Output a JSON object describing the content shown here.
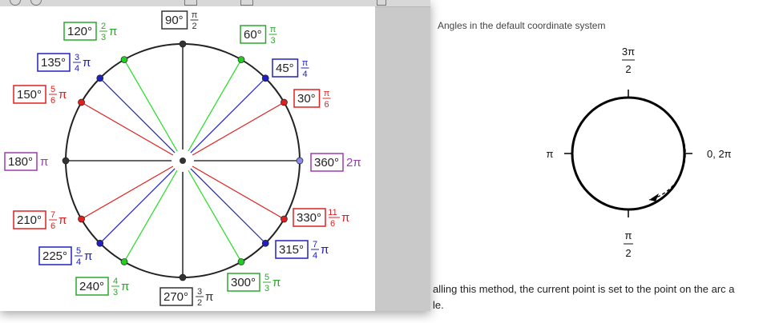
{
  "doc": {
    "caption": "Angles in the default coordinate system",
    "body_line_1": "alling this method, the current point is set to the point on the arc a",
    "body_line_2": "le.",
    "diagram": {
      "top_label_num": "3π",
      "top_label_den": "2",
      "left_label": "π",
      "right_label": "0, 2π",
      "bottom_label_num": "π",
      "bottom_label_den": "2"
    }
  },
  "unit_circle": {
    "angles": [
      {
        "id": "deg-0",
        "deg": 0,
        "label": "360°",
        "rad_num": "",
        "rad_den": "",
        "rad_tail": "2π",
        "color": "#9a3fb0",
        "dot": "#8a8ae8"
      },
      {
        "id": "deg-30",
        "deg": 30,
        "label": "30°",
        "rad_num": "π",
        "rad_den": "6",
        "rad_tail": "",
        "color": "#e02020",
        "dot": "#e02020"
      },
      {
        "id": "deg-45",
        "deg": 45,
        "label": "45°",
        "rad_num": "π",
        "rad_den": "4",
        "rad_tail": "",
        "color": "#2020c0",
        "dot": "#2020c0"
      },
      {
        "id": "deg-60",
        "deg": 60,
        "label": "60°",
        "rad_num": "π",
        "rad_den": "3",
        "rad_tail": "",
        "color": "#2aa82a",
        "dot": "#22cc22"
      },
      {
        "id": "deg-90",
        "deg": 90,
        "label": "90°",
        "rad_num": "π",
        "rad_den": "2",
        "rad_tail": "",
        "color": "#333333",
        "dot": "#333333"
      },
      {
        "id": "deg-120",
        "deg": 120,
        "label": "120°",
        "rad_num": "2",
        "rad_den": "3",
        "rad_tail": "π",
        "color": "#2aa82a",
        "dot": "#22cc22"
      },
      {
        "id": "deg-135",
        "deg": 135,
        "label": "135°",
        "rad_num": "3",
        "rad_den": "4",
        "rad_tail": "π",
        "color": "#2020c0",
        "dot": "#2020c0"
      },
      {
        "id": "deg-150",
        "deg": 150,
        "label": "150°",
        "rad_num": "5",
        "rad_den": "6",
        "rad_tail": "π",
        "color": "#e02020",
        "dot": "#e02020"
      },
      {
        "id": "deg-180",
        "deg": 180,
        "label": "180°",
        "rad_num": "",
        "rad_den": "",
        "rad_tail": "π",
        "color": "#9a3fb0",
        "dot": "#333333"
      },
      {
        "id": "deg-210",
        "deg": 210,
        "label": "210°",
        "rad_num": "7",
        "rad_den": "6",
        "rad_tail": "π",
        "color": "#e02020",
        "dot": "#e02020"
      },
      {
        "id": "deg-225",
        "deg": 225,
        "label": "225°",
        "rad_num": "5",
        "rad_den": "4",
        "rad_tail": "π",
        "color": "#2020c0",
        "dot": "#2020c0"
      },
      {
        "id": "deg-240",
        "deg": 240,
        "label": "240°",
        "rad_num": "4",
        "rad_den": "3",
        "rad_tail": "π",
        "color": "#2aa82a",
        "dot": "#22cc22"
      },
      {
        "id": "deg-270",
        "deg": 270,
        "label": "270°",
        "rad_num": "3",
        "rad_den": "2",
        "rad_tail": "π",
        "color": "#333333",
        "dot": "#333333"
      },
      {
        "id": "deg-300",
        "deg": 300,
        "label": "300°",
        "rad_num": "5",
        "rad_den": "3",
        "rad_tail": "π",
        "color": "#2aa82a",
        "dot": "#22cc22"
      },
      {
        "id": "deg-315",
        "deg": 315,
        "label": "315°",
        "rad_num": "7",
        "rad_den": "4",
        "rad_tail": "π",
        "color": "#2020c0",
        "dot": "#2020c0"
      },
      {
        "id": "deg-330",
        "deg": 330,
        "label": "330°",
        "rad_num": "11",
        "rad_den": "6",
        "rad_tail": "π",
        "color": "#e02020",
        "dot": "#e02020"
      }
    ]
  }
}
